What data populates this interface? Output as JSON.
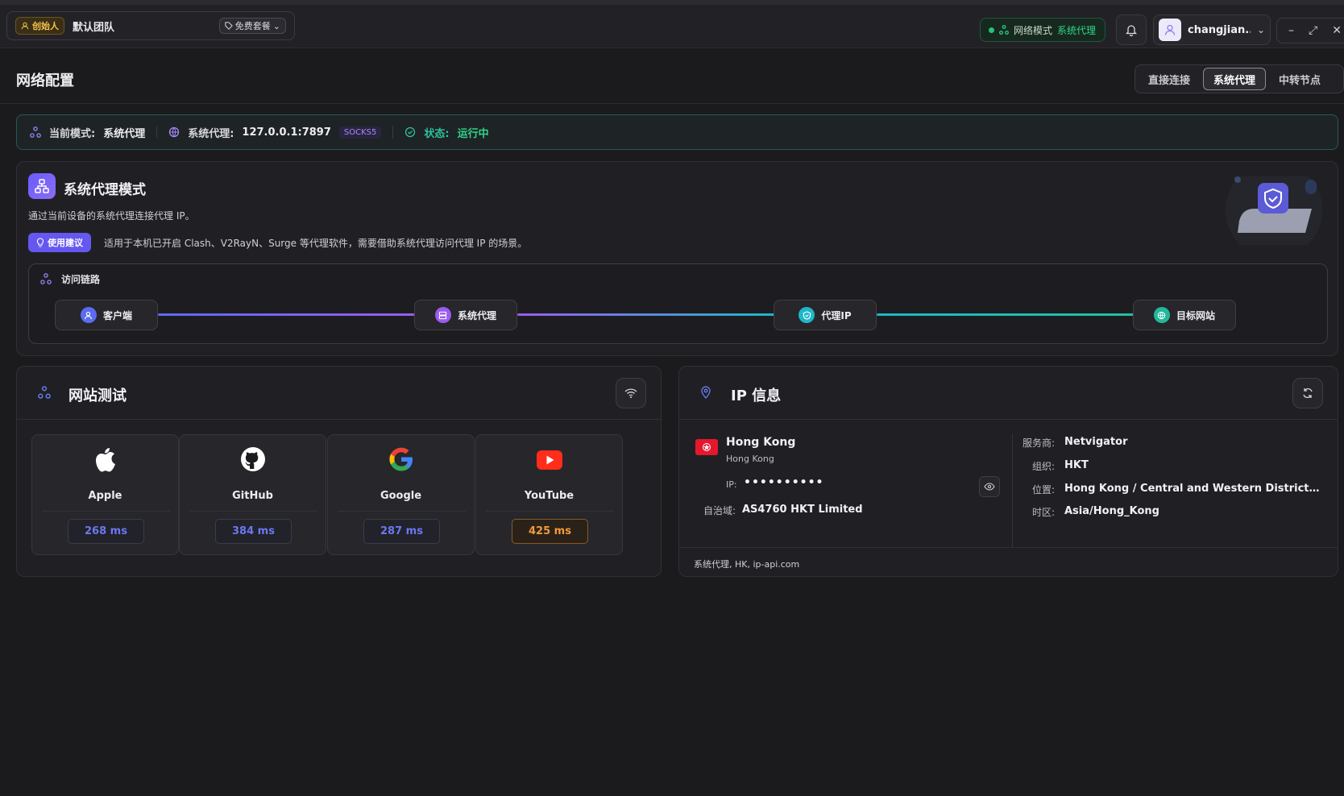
{
  "topbar": {
    "creator_badge": "创始人",
    "team_name": "默认团队",
    "plan_badge": "免费套餐",
    "mode_label": "网络模式",
    "mode_value": "系统代理",
    "user_name": "changjian..."
  },
  "page": {
    "title": "网络配置",
    "tabs": [
      "直接连接",
      "系统代理",
      "中转节点"
    ],
    "active_tab": "系统代理"
  },
  "status": {
    "mode_key": "当前模式:",
    "mode_val": "系统代理",
    "proxy_key": "系统代理:",
    "proxy_val": "127.0.0.1:7897",
    "proxy_type": "SOCKS5",
    "state_key": "状态:",
    "state_val": "运行中"
  },
  "mode_card": {
    "title": "系统代理模式",
    "desc": "通过当前设备的系统代理连接代理 IP。",
    "tip_label": "使用建议",
    "tip_text": "适用于本机已开启 Clash、V2RayN、Surge 等代理软件，需要借助系统代理访问代理 IP 的场景。",
    "chain_title": "访问链路",
    "chain": [
      {
        "label": "客户端",
        "color": "#6a7cf5"
      },
      {
        "label": "系统代理",
        "color": "#9a6cf0"
      },
      {
        "label": "代理IP",
        "color": "#1fb7c8"
      },
      {
        "label": "目标网站",
        "color": "#22b79a"
      }
    ]
  },
  "site_test": {
    "title": "网站测试",
    "sites": [
      {
        "name": "Apple",
        "latency": "268 ms",
        "icon": "apple-icon"
      },
      {
        "name": "GitHub",
        "latency": "384 ms",
        "icon": "github-icon"
      },
      {
        "name": "Google",
        "latency": "287 ms",
        "icon": "google-icon"
      },
      {
        "name": "YouTube",
        "latency": "425 ms",
        "icon": "youtube-icon"
      }
    ]
  },
  "ip_info": {
    "title": "IP 信息",
    "city": "Hong Kong",
    "region": "Hong Kong",
    "ip_label": "IP:",
    "ip_masked": "••••••••••",
    "as_key": "自治域:",
    "as_val": "AS4760 HKT Limited",
    "details": [
      {
        "k": "服务商:",
        "v": "Netvigator"
      },
      {
        "k": "组织:",
        "v": "HKT"
      },
      {
        "k": "位置:",
        "v": "Hong Kong / Central and Western District / Hong ..."
      },
      {
        "k": "时区:",
        "v": "Asia/Hong_Kong"
      }
    ],
    "footer": "系统代理, HK, ip-api.com"
  }
}
